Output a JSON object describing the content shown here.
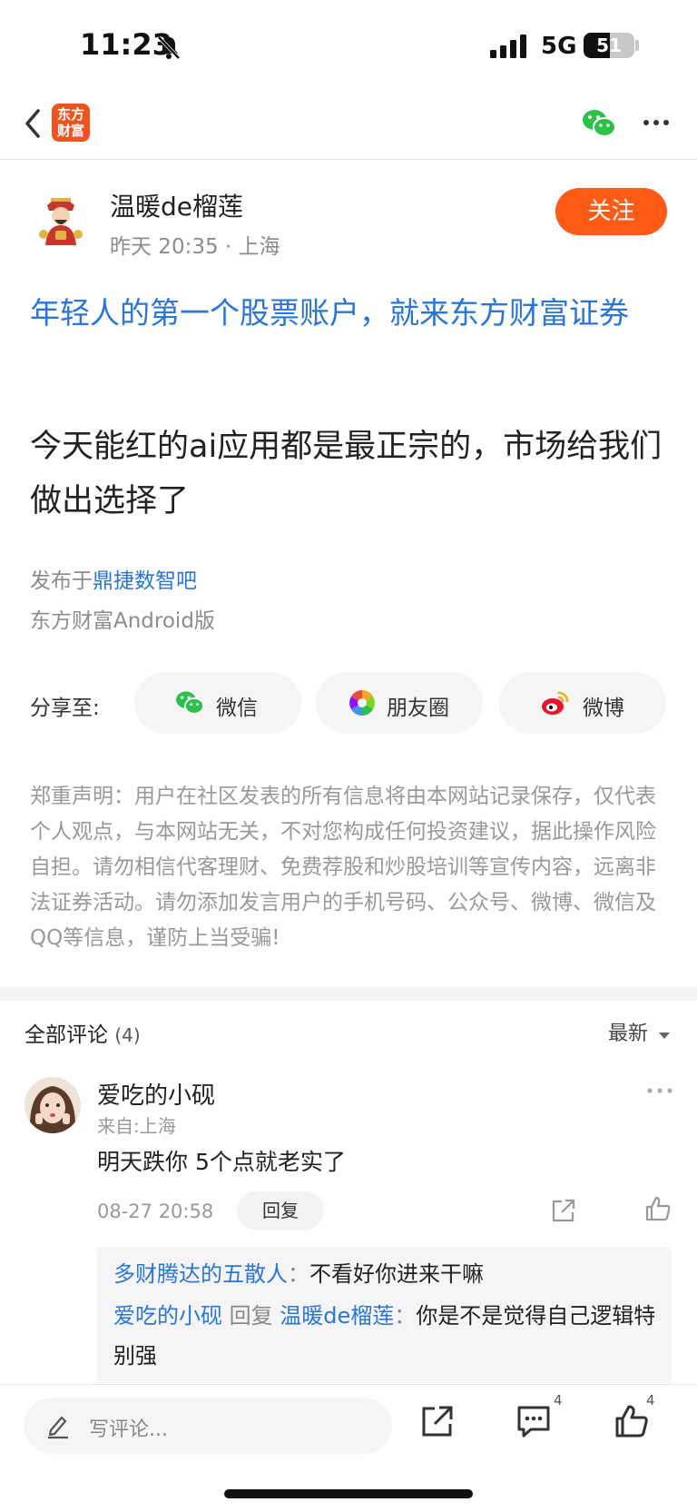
{
  "status_bar": {
    "time": "11:23",
    "network": "5G",
    "battery_level": "51",
    "battery_fraction": 0.51
  },
  "nav": {
    "logo_line1": "东方",
    "logo_line2": "财富"
  },
  "post": {
    "author_name": "温暖de榴莲",
    "meta": "昨天 20:35 · 上海",
    "follow_label": "关注",
    "ad_text": "年轻人的第一个股票账户，就来东方财富证券",
    "body": "今天能红的ai应用都是最正宗的，市场给我们做出选择了",
    "published_prefix": "发布于",
    "bar_name": "鼎捷数智吧",
    "client": "东方财富Android版"
  },
  "share": {
    "label": "分享至:",
    "options": [
      {
        "label": "微信",
        "icon": "wechat-icon"
      },
      {
        "label": "朋友圈",
        "icon": "moments-icon"
      },
      {
        "label": "微博",
        "icon": "weibo-icon"
      }
    ]
  },
  "disclaimer": "郑重声明：用户在社区发表的所有信息将由本网站记录保存，仅代表个人观点，与本网站无关，不对您构成任何投资建议，据此操作风险自担。请勿相信代客理财、免费荐股和炒股培训等宣传内容，远离非法证券活动。请勿添加发言用户的手机号码、公众号、微博、微信及QQ等信息，谨防上当受骗!",
  "comments": {
    "title": "全部评论",
    "count": "(4)",
    "sort_label": "最新",
    "items": [
      {
        "name": "爱吃的小砚",
        "location": "来自:上海",
        "text": "明天跌你 5个点就老实了",
        "time": "08-27 20:58",
        "reply_label": "回复",
        "replies": [
          {
            "user": "多财腾达的五散人",
            "sep": "：",
            "text": "不看好你进来干嘛"
          },
          {
            "user": "爱吃的小砚",
            "verb": "回复",
            "target": "温暖de榴莲",
            "sep": "：",
            "text": "你是不是觉得自己逻辑特别强"
          }
        ]
      }
    ]
  },
  "bottom_bar": {
    "placeholder": "写评论...",
    "comment_count": "4",
    "like_count": "4"
  },
  "colors": {
    "accent": "#ff5a16",
    "link": "#2a76d8",
    "logo": "#f0541e"
  }
}
